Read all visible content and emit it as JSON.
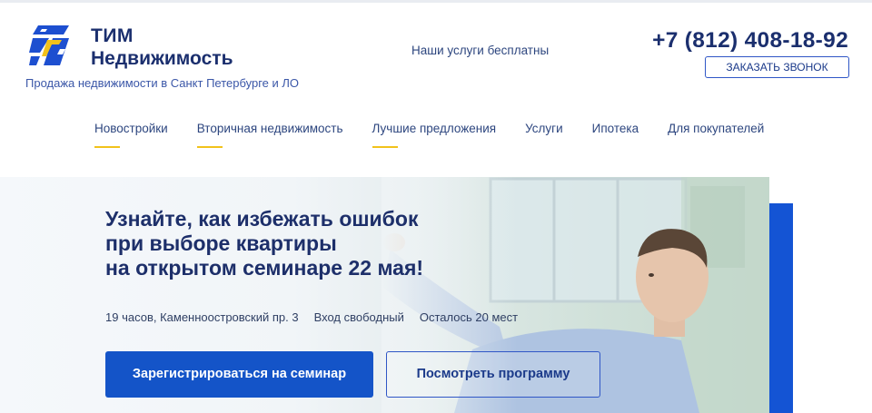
{
  "header": {
    "brand_line1": "ТИМ",
    "brand_line2": "Недвижимость",
    "tagline": "Продажа недвижимости в Санкт Петербурге и ЛО",
    "free_services": "Наши услуги бесплатны",
    "phone": "+7 (812) 408-18-92",
    "callback_label": "ЗАКАЗАТЬ ЗВОНОК",
    "logo_icon": "tim-logo-icon"
  },
  "nav": {
    "items": [
      {
        "label": "Новостройки",
        "underlined": true
      },
      {
        "label": "Вторичная недвижимость",
        "underlined": true
      },
      {
        "label": "Лучшие предложения",
        "underlined": true
      },
      {
        "label": "Услуги",
        "underlined": false
      },
      {
        "label": "Ипотека",
        "underlined": false
      },
      {
        "label": "Для покупателей",
        "underlined": false
      }
    ]
  },
  "hero": {
    "title_lines": [
      "Узнайте, как избежать ошибок",
      "при выборе квартиры",
      "на открытом семинаре 22 мая!"
    ],
    "info": [
      "19 часов, Каменноостровский пр. 3",
      "Вход свободный",
      "Осталось 20 мест"
    ],
    "register_label": "Зарегистрироваться на семинар",
    "program_label": "Посмотреть программу"
  },
  "colors": {
    "brand_dark": "#1b2f6e",
    "accent_blue": "#1454c8",
    "nav_underline": "#f2c21b"
  }
}
